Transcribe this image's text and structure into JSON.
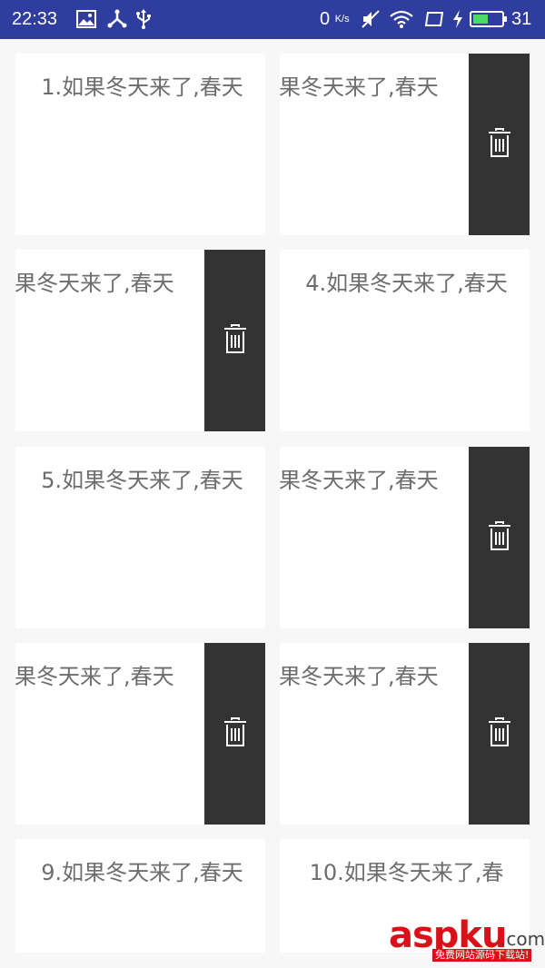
{
  "status_bar": {
    "time": "22:33",
    "net_speed_value": "0",
    "net_speed_unit": "K/s",
    "battery_level": "31",
    "icons": [
      "image-icon",
      "share-icon",
      "usb-icon",
      "mute-icon",
      "wifi-icon",
      "screen-icon",
      "charging-icon",
      "battery-icon"
    ]
  },
  "grid": {
    "cards": [
      {
        "text": "1.如果冬天来了,春天",
        "swiped": false
      },
      {
        "text": "果冬天来了,春天",
        "swiped": true
      },
      {
        "text": "果冬天来了,春天",
        "swiped": true
      },
      {
        "text": "4.如果冬天来了,春天",
        "swiped": false
      },
      {
        "text": "5.如果冬天来了,春天",
        "swiped": false
      },
      {
        "text": "果冬天来了,春天",
        "swiped": true
      },
      {
        "text": "果冬天来了,春天",
        "swiped": true
      },
      {
        "text": "果冬天来了,春天",
        "swiped": true
      },
      {
        "text": "9.如果冬天来了,春天",
        "swiped": false
      },
      {
        "text": "10.如果冬天来了,春",
        "swiped": false
      }
    ],
    "delete_icon": "trash-icon"
  },
  "watermark": {
    "main": "aspku",
    "suffix": ".com",
    "sub": "免费网站源码下载站!"
  },
  "colors": {
    "status_bar": "#2f3e9e",
    "delete_pane": "#333333",
    "card_text": "#6d6d6d",
    "watermark": "#d9121a"
  }
}
